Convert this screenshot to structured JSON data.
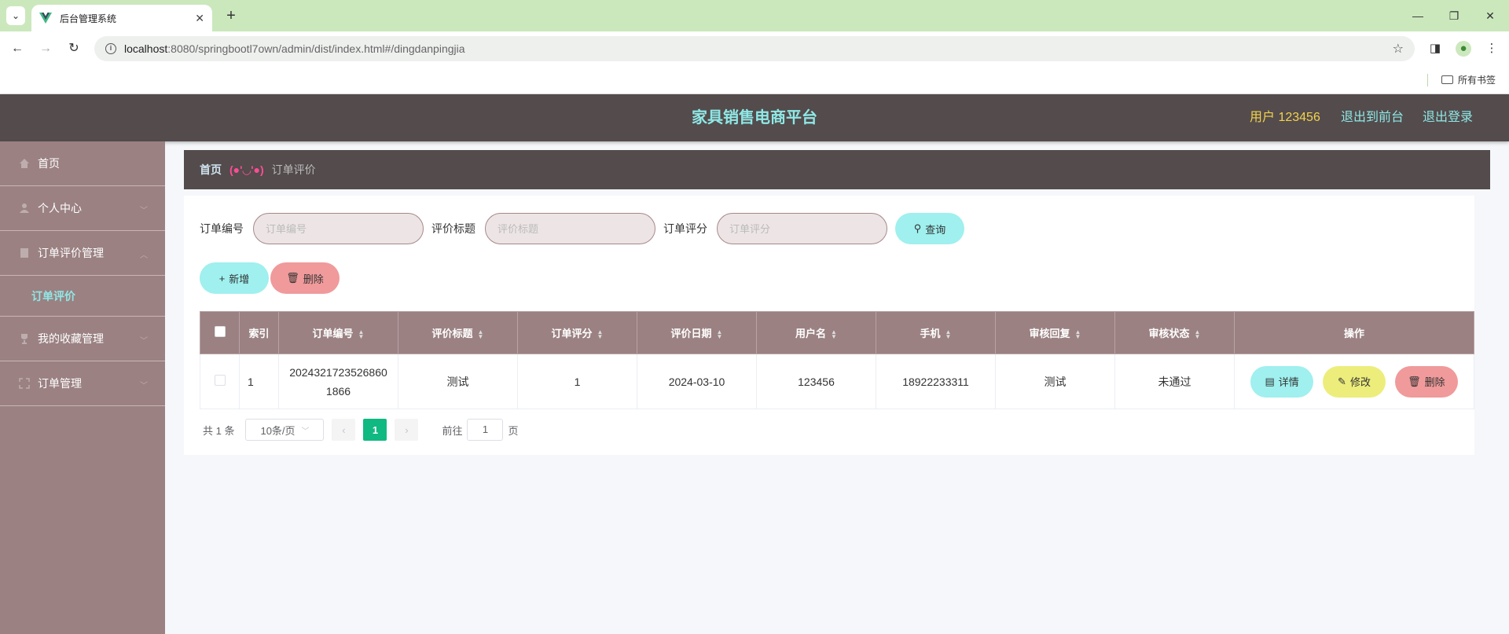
{
  "browser": {
    "tab_title": "后台管理系统",
    "url_host": "localhost",
    "url_path": ":8080/springbootl7own/admin/dist/index.html#/dingdanpingjia",
    "bookmarks_label": "所有书签"
  },
  "header": {
    "title": "家具销售电商平台",
    "user": "用户 123456",
    "to_front": "退出到前台",
    "logout": "退出登录"
  },
  "sidebar": {
    "items": [
      {
        "label": "首页"
      },
      {
        "label": "个人中心"
      },
      {
        "label": "订单评价管理"
      },
      {
        "label": "订单评价"
      },
      {
        "label": "我的收藏管理"
      },
      {
        "label": "订单管理"
      }
    ]
  },
  "breadcrumb": {
    "home": "首页",
    "separator": "(●'◡'●)",
    "current": "订单评价"
  },
  "search": {
    "order_no_label": "订单编号",
    "order_no_placeholder": "订单编号",
    "title_label": "评价标题",
    "title_placeholder": "评价标题",
    "score_label": "订单评分",
    "score_placeholder": "订单评分",
    "query_button": "查询"
  },
  "actions": {
    "add": "新增",
    "delete": "删除"
  },
  "table": {
    "headers": [
      "索引",
      "订单编号",
      "评价标题",
      "订单评分",
      "评价日期",
      "用户名",
      "手机",
      "审核回复",
      "审核状态",
      "操作"
    ],
    "rows": [
      {
        "index": "1",
        "order_no_line1": "2024321723526860",
        "order_no_line2": "1866",
        "title": "测试",
        "score": "1",
        "date": "2024-03-10",
        "username": "123456",
        "phone": "18922233311",
        "reply": "测试",
        "status": "未通过"
      }
    ],
    "op_detail": "详情",
    "op_edit": "修改",
    "op_delete": "删除"
  },
  "pager": {
    "total": "共 1 条",
    "page_size": "10条/页",
    "current_page": "1",
    "goto_label": "前往",
    "goto_value": "1",
    "page_suffix": "页"
  },
  "colors": {
    "header_bg": "#534b4c",
    "sidebar_bg": "#9b8182",
    "accent_cyan": "#9ff0ee",
    "accent_red": "#f09a9b",
    "accent_yellow": "#eded7c",
    "pager_active": "#10b981"
  }
}
